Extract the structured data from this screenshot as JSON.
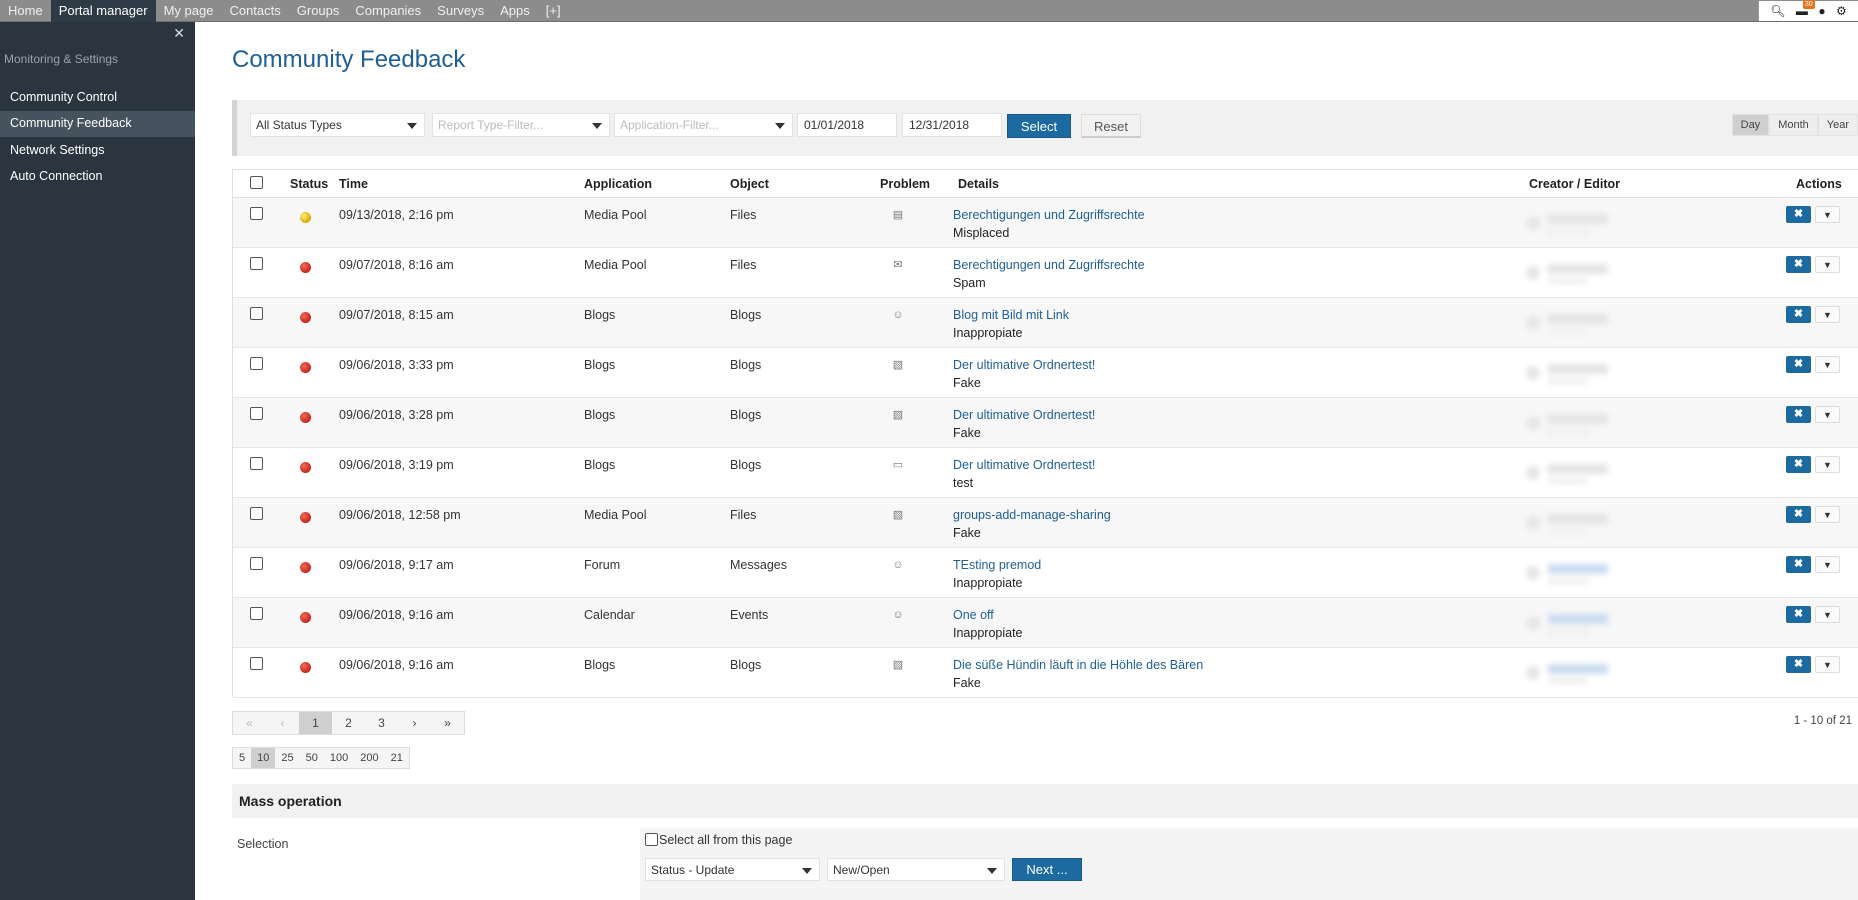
{
  "nav": {
    "items": [
      "Home",
      "Portal manager",
      "My page",
      "Contacts",
      "Groups",
      "Companies",
      "Surveys",
      "Apps",
      "[+]"
    ],
    "active_index": 1,
    "notifications_count": "30"
  },
  "sidebar": {
    "close": "✕",
    "section": "Monitoring & Settings",
    "items": [
      "Community Control",
      "Community Feedback",
      "Network Settings",
      "Auto Connection"
    ],
    "active_index": 1
  },
  "page": {
    "title": "Community Feedback"
  },
  "filters": {
    "status": "All Status Types",
    "report_type_placeholder": "Report Type-Filter...",
    "application_placeholder": "Application-Filter...",
    "date_from": "01/01/2018",
    "date_to": "12/31/2018",
    "select_label": "Select",
    "reset_label": "Reset",
    "periods": [
      "Day",
      "Month",
      "Year"
    ],
    "active_period": "Day"
  },
  "table": {
    "headers": [
      "Status",
      "Time",
      "Application",
      "Object",
      "Problem",
      "Details",
      "Creator / Editor",
      "Actions"
    ],
    "rows": [
      {
        "status": "ok",
        "time": "09/13/2018, 2:16 pm",
        "application": "Media Pool",
        "object": "Files",
        "problem_icon": "report-icon",
        "title": "Berechtigungen und Zugriffsrechte",
        "reason": "Misplaced"
      },
      {
        "status": "open",
        "time": "09/07/2018, 8:16 am",
        "application": "Media Pool",
        "object": "Files",
        "problem_icon": "mail-icon",
        "title": "Berechtigungen und Zugriffsrechte",
        "reason": "Spam"
      },
      {
        "status": "open",
        "time": "09/07/2018, 8:15 am",
        "application": "Blogs",
        "object": "Blogs",
        "problem_icon": "user-icon",
        "title": "Blog mit Bild mit Link",
        "reason": "Inappropiate"
      },
      {
        "status": "open",
        "time": "09/06/2018, 3:33 pm",
        "application": "Blogs",
        "object": "Blogs",
        "problem_icon": "document-icon",
        "title": "Der ultimative Ordnertest!",
        "reason": "Fake"
      },
      {
        "status": "open",
        "time": "09/06/2018, 3:28 pm",
        "application": "Blogs",
        "object": "Blogs",
        "problem_icon": "document-icon",
        "title": "Der ultimative Ordnertest!",
        "reason": "Fake"
      },
      {
        "status": "open",
        "time": "09/06/2018, 3:19 pm",
        "application": "Blogs",
        "object": "Blogs",
        "problem_icon": "window-icon",
        "title": "Der ultimative Ordnertest!",
        "reason": "test"
      },
      {
        "status": "open",
        "time": "09/06/2018, 12:58 pm",
        "application": "Media Pool",
        "object": "Files",
        "problem_icon": "document-icon",
        "title": "groups-add-manage-sharing",
        "reason": "Fake"
      },
      {
        "status": "open",
        "time": "09/06/2018, 9:17 am",
        "application": "Forum",
        "object": "Messages",
        "problem_icon": "user-icon",
        "title": "TEsting premod",
        "reason": "Inappropiate"
      },
      {
        "status": "open",
        "time": "09/06/2018, 9:16 am",
        "application": "Calendar",
        "object": "Events",
        "problem_icon": "user-icon",
        "title": "One off",
        "reason": "Inappropiate"
      },
      {
        "status": "open",
        "time": "09/06/2018, 9:16 am",
        "application": "Blogs",
        "object": "Blogs",
        "problem_icon": "document-icon",
        "title": "Die süße Hündin läuft in die Höhle des Bären",
        "reason": "Fake"
      }
    ]
  },
  "pagination": {
    "first": "«",
    "prev": "‹",
    "pages": [
      "1",
      "2",
      "3"
    ],
    "current": "1",
    "next": "›",
    "last": "»",
    "count_text": "1 - 10 of 21",
    "sizes": [
      "5",
      "10",
      "25",
      "50",
      "100",
      "200",
      "21"
    ],
    "current_size": "10"
  },
  "mass_operation": {
    "title": "Mass operation",
    "selection_label": "Selection",
    "select_all_label": "Select all from this page",
    "operation": "Status - Update",
    "value": "New/Open",
    "next_label": "Next ..."
  },
  "colors": {
    "accent": "#1c6aa0",
    "title": "#1f5f94",
    "sidebar": "#2a3540",
    "topbar": "#8c8c8c",
    "status_open": "#d12d20",
    "status_ok": "#e5b800"
  }
}
